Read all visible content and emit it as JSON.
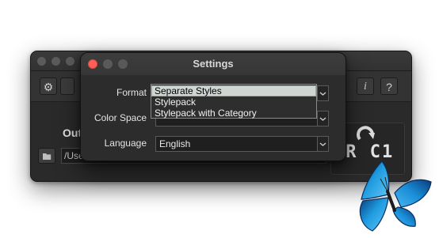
{
  "settings_dialog": {
    "title": "Settings",
    "format_label": "Format",
    "color_space_label": "Color Space",
    "color_space_value": "",
    "language_label": "Language",
    "language_value": "English",
    "format_options": [
      "Separate Styles",
      "Stylepack",
      "Stylepack with Category"
    ],
    "format_selected": "Separate Styles"
  },
  "main_window": {
    "output_label": "Out",
    "path_value": "/Use",
    "badge_text": "LR C1"
  },
  "icons": {
    "settings": "gear-icon",
    "info": "info-icon",
    "help": "help-icon",
    "folder": "folder-icon",
    "refresh": "refresh-arrow-icon",
    "butterfly": "butterfly-icon"
  },
  "colors": {
    "close_red": "#ff5f57",
    "butterfly_blue": "#1e9be0"
  }
}
